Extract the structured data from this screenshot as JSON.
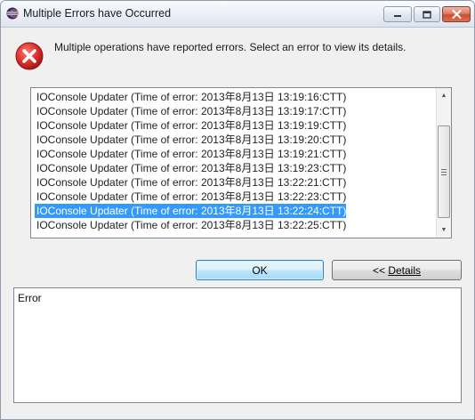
{
  "window": {
    "title": "Multiple Errors have Occurred",
    "controls": {
      "minimize": "minimize",
      "maximize": "maximize",
      "close": "close"
    }
  },
  "icons": {
    "title": "eclipse-icon",
    "message": "error-icon",
    "close": "close-icon",
    "minimize": "minimize-icon",
    "maximize": "maximize-icon"
  },
  "message": "Multiple operations have reported errors. Select an error to view its details.",
  "errors": {
    "items": [
      "IOConsole Updater (Time of error: 2013年8月13日 13:19:16:CTT)",
      "IOConsole Updater (Time of error: 2013年8月13日 13:19:17:CTT)",
      "IOConsole Updater (Time of error: 2013年8月13日 13:19:19:CTT)",
      "IOConsole Updater (Time of error: 2013年8月13日 13:19:20:CTT)",
      "IOConsole Updater (Time of error: 2013年8月13日 13:19:21:CTT)",
      "IOConsole Updater (Time of error: 2013年8月13日 13:19:23:CTT)",
      "IOConsole Updater (Time of error: 2013年8月13日 13:22:21:CTT)",
      "IOConsole Updater (Time of error: 2013年8月13日 13:22:23:CTT)",
      "IOConsole Updater (Time of error: 2013年8月13日 13:22:24:CTT)",
      "IOConsole Updater (Time of error: 2013年8月13日 13:22:25:CTT)"
    ],
    "selected_index": 8
  },
  "buttons": {
    "ok": "OK",
    "details_prefix": "<< ",
    "details_label": "Details"
  },
  "details": {
    "text": "Error"
  },
  "colors": {
    "selection": "#3399ff",
    "error_red": "#d8262b",
    "ok_border": "#3c7fb1"
  }
}
